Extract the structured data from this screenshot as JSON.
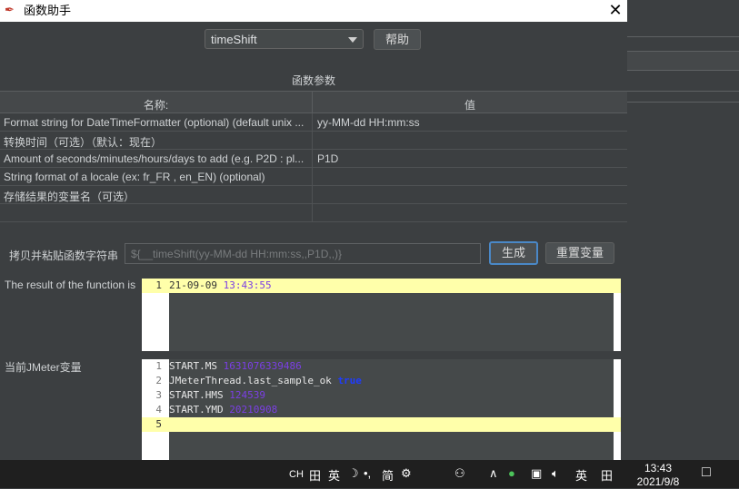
{
  "dialog": {
    "title": "函数助手",
    "function_select": {
      "value": "timeShift"
    },
    "help_button": "帮助",
    "params_title": "函数参数"
  },
  "params_table": {
    "headers": [
      "名称:",
      "值"
    ],
    "rows": [
      {
        "name": "Format string for DateTimeFormatter (optional) (default unix ...",
        "value": "yy-MM-dd HH:mm:ss"
      },
      {
        "name": "转换时间（可选）（默认：现在）",
        "value": ""
      },
      {
        "name": "Amount of seconds/minutes/hours/days to add (e.g. P2D : pl...",
        "value": "P1D"
      },
      {
        "name": "String format of a locale (ex: fr_FR , en_EN) (optional)",
        "value": ""
      },
      {
        "name": "存储结果的变量名（可选）",
        "value": ""
      },
      {
        "name": "",
        "value": ""
      }
    ]
  },
  "copy_row": {
    "label": "拷贝并粘贴函数字符串",
    "value": "${__timeShift(yy-MM-dd HH:mm:ss,,P1D,,)}",
    "generate_button": "生成",
    "reset_button": "重置变量"
  },
  "result": {
    "label": "The result of the function is",
    "lines": [
      {
        "num": "1",
        "parts": [
          "21-09-09 ",
          "13:43:55"
        ]
      }
    ]
  },
  "vars": {
    "label": "当前JMeter变量",
    "lines": [
      {
        "num": "1",
        "key": "START.MS ",
        "val": "1631076339486",
        "kind": "num"
      },
      {
        "num": "2",
        "key": "JMeterThread.last_sample_ok ",
        "val": "true",
        "kind": "bool"
      },
      {
        "num": "3",
        "key": "START.HMS ",
        "val": "124539",
        "kind": "num"
      },
      {
        "num": "4",
        "key": "START.YMD ",
        "val": "20210908",
        "kind": "num"
      },
      {
        "num": "5",
        "key": "",
        "val": "",
        "kind": "empty"
      }
    ]
  },
  "taskbar": {
    "ime_ch": "CH",
    "ime_lang": "英",
    "ime_simplified": "简",
    "lang2": "英",
    "time": "13:43",
    "date": "2021/9/8"
  }
}
